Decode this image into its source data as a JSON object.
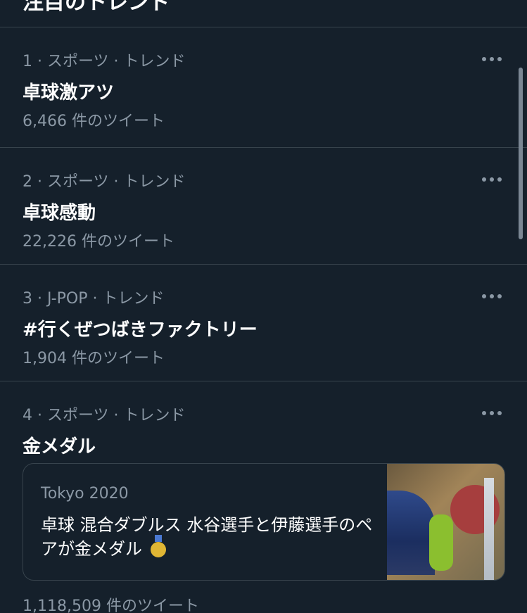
{
  "header": {
    "title": "注目のトレンド"
  },
  "trends": [
    {
      "meta": "1 · スポーツ · トレンド",
      "title": "卓球激アツ",
      "count": "6,466 件のツイート"
    },
    {
      "meta": "2 · スポーツ · トレンド",
      "title": "卓球感動",
      "count": "22,226 件のツイート"
    },
    {
      "meta": "3 · J-POP · トレンド",
      "title": "#行くぜつばきファクトリー",
      "count": "1,904 件のツイート"
    },
    {
      "meta": "4 · スポーツ · トレンド",
      "title": "金メダル",
      "card": {
        "source": "Tokyo 2020",
        "text": "卓球 混合ダブルス 水谷選手と伊藤選手のペアが金メダル"
      },
      "count": "1,118,509 件のツイート"
    }
  ],
  "icons": {
    "more": "more-icon",
    "medal": "medal-icon"
  },
  "colors": {
    "background": "#15202b",
    "text_primary": "#ffffff",
    "text_secondary": "#8b98a5",
    "divider": "#38444d"
  }
}
